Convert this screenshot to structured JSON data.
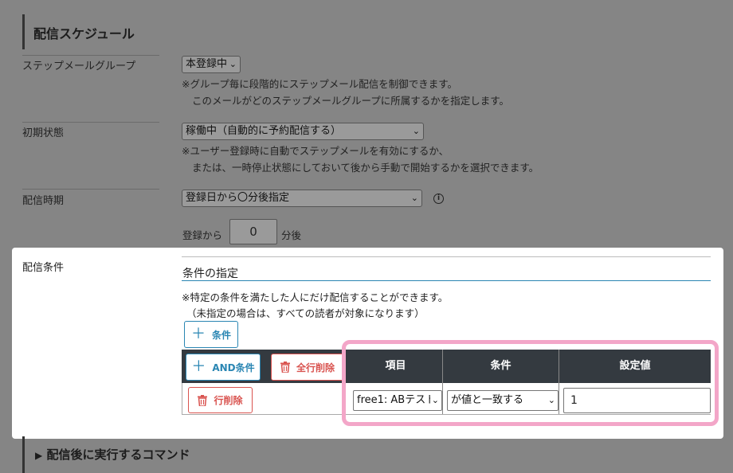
{
  "schedule": {
    "title": "配信スケジュール",
    "group_label": "ステップメールグループ",
    "group_value": "本登録中",
    "group_note1": "※グループ毎に段階的にステップメール配信を制御できます。",
    "group_note2": "このメールがどのステップメールグループに所属するかを指定します。",
    "initial_label": "初期状態",
    "initial_value": "稼働中（自動的に予約配信する）",
    "initial_note1": "※ユーザー登録時に自動でステップメールを有効にするか、",
    "initial_note2": "または、一時停止状態にしておいて後から手動で開始するかを選択できます。",
    "timing_label": "配信時期",
    "timing_value": "登録日から〇分後指定",
    "timing_prefix": "登録から",
    "timing_number": "0",
    "timing_suffix": "分後"
  },
  "conditions": {
    "label": "配信条件",
    "heading": "条件の指定",
    "note1": "※特定の条件を満たした人にだけ配信することができます。",
    "note2": "（未指定の場合は、すべての読者が対象になります）",
    "add_condition": "条件",
    "and_condition": "AND条件",
    "delete_all": "全行削除",
    "delete_row": "行削除",
    "columns": [
      "項目",
      "条件",
      "設定値"
    ],
    "row": {
      "item": "free1: ABテスト",
      "operator": "が値と一致する",
      "value": "1"
    }
  },
  "post_command": {
    "title": "配信後に実行するコマンド"
  },
  "colors": {
    "overlay": "#858585",
    "accent_blue": "#2a86b3",
    "danger_red": "#d9534f",
    "header_dark": "#343a40",
    "highlight_pink": "#f3a6c8"
  }
}
